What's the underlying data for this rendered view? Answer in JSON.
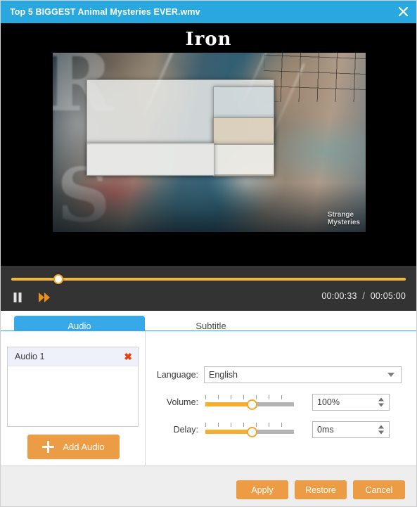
{
  "window": {
    "title": "Top 5 BIGGEST Animal Mysteries EVER.wmv",
    "close_icon": "close-icon",
    "accent_color": "#29a8e0"
  },
  "video": {
    "overlay_title": "Iron",
    "watermark_line1": "Strange",
    "watermark_line2": "Mysteries"
  },
  "player": {
    "progress_percent": 11,
    "pause_icon": "pause-icon",
    "forward_icon": "fast-forward-icon",
    "current_time": "00:00:33",
    "time_separator": "/",
    "total_time": "00:05:00",
    "track_color": "#f5b63d"
  },
  "tabs": [
    {
      "label": "Audio",
      "active": true
    },
    {
      "label": "Subtitle",
      "active": false
    }
  ],
  "audio_panel": {
    "list": [
      {
        "label": "Audio 1",
        "remove_icon": "remove-icon",
        "selected": true
      }
    ],
    "add_button": {
      "label": "Add Audio",
      "icon": "plus-icon"
    },
    "fields": {
      "language": {
        "label": "Language:",
        "value": "English",
        "arrow_icon": "chevron-down-icon"
      },
      "volume": {
        "label": "Volume:",
        "value": "100%",
        "slider_percent": 53
      },
      "delay": {
        "label": "Delay:",
        "value": "0ms",
        "slider_percent": 53
      }
    }
  },
  "footer": {
    "apply_label": "Apply",
    "restore_label": "Restore",
    "cancel_label": "Cancel",
    "button_color": "#eb9c45"
  }
}
